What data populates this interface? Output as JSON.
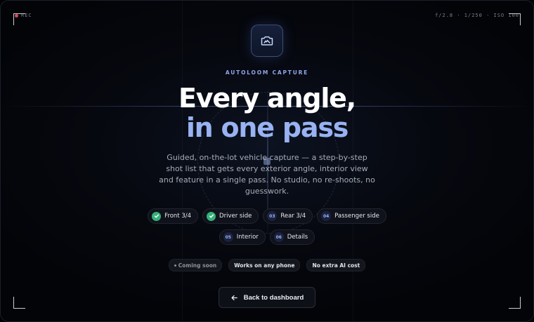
{
  "hud": {
    "rec_label": "REC",
    "exposure": "f/2.8 · 1/250 · ISO 100"
  },
  "hero": {
    "icon": "camera-icon",
    "eyebrow": "AUTOLOOM CAPTURE",
    "title_line1": "Every angle,",
    "title_line2": "in one pass",
    "description": "Guided, on-the-lot vehicle capture — a step-by-step shot list that gets every exterior angle, interior view and feature in a single pass. No studio, no re-shoots, no guesswork."
  },
  "steps": [
    {
      "label": "Front 3/4",
      "done": true,
      "number": ""
    },
    {
      "label": "Driver side",
      "done": true,
      "number": ""
    },
    {
      "label": "Rear 3/4",
      "done": false,
      "number": "03"
    },
    {
      "label": "Passenger side",
      "done": false,
      "number": "04"
    },
    {
      "label": "Interior",
      "done": false,
      "number": "05"
    },
    {
      "label": "Details",
      "done": false,
      "number": "06"
    }
  ],
  "badges": {
    "coming_soon": "Coming soon",
    "any_phone": "Works on any phone",
    "no_ai_cost": "No extra AI cost"
  },
  "actions": {
    "back_label": "Back to dashboard",
    "back_icon": "arrow-left-icon"
  },
  "colors": {
    "accent": "#98b2f2",
    "eyebrow": "#8fa6e8",
    "success": "#35b07a",
    "rec": "#e0455a",
    "background": "#06080f"
  }
}
